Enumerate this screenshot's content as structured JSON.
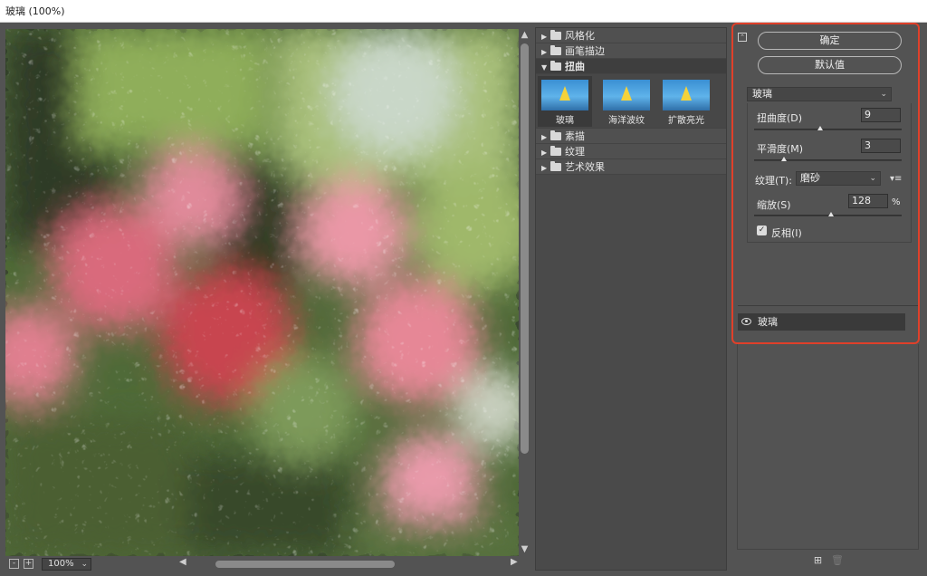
{
  "window": {
    "title": "玻璃 (100%)"
  },
  "preview": {
    "zoom": "100%",
    "zoom_out_label": "-",
    "zoom_in_label": "+",
    "scroll_up": "▲",
    "scroll_down": "▼",
    "scroll_left": "◀",
    "scroll_right": "▶"
  },
  "gallery": {
    "categories": [
      {
        "label": "风格化",
        "expanded": false
      },
      {
        "label": "画笔描边",
        "expanded": false
      },
      {
        "label": "扭曲",
        "expanded": true
      },
      {
        "label": "素描",
        "expanded": false
      },
      {
        "label": "纹理",
        "expanded": false
      },
      {
        "label": "艺术效果",
        "expanded": false
      }
    ],
    "distort_filters": [
      {
        "label": "玻璃",
        "selected": true
      },
      {
        "label": "海洋波纹",
        "selected": false
      },
      {
        "label": "扩散亮光",
        "selected": false
      }
    ]
  },
  "panel": {
    "ok_label": "确定",
    "default_label": "默认值",
    "filter_select": "玻璃",
    "distortion": {
      "label": "扭曲度(D)",
      "value": "9",
      "fraction": 0.45
    },
    "smoothness": {
      "label": "平滑度(M)",
      "value": "3",
      "fraction": 0.2
    },
    "texture": {
      "label": "纹理(T):",
      "value": "磨砂"
    },
    "scaling": {
      "label": "缩放(S)",
      "value": "128",
      "unit": "%",
      "fraction": 0.52
    },
    "invert": {
      "label": "反相(I)",
      "checked": true
    },
    "layer_name": "玻璃"
  },
  "colors": {
    "highlight": "#e0402a",
    "panel_bg": "#535353"
  }
}
